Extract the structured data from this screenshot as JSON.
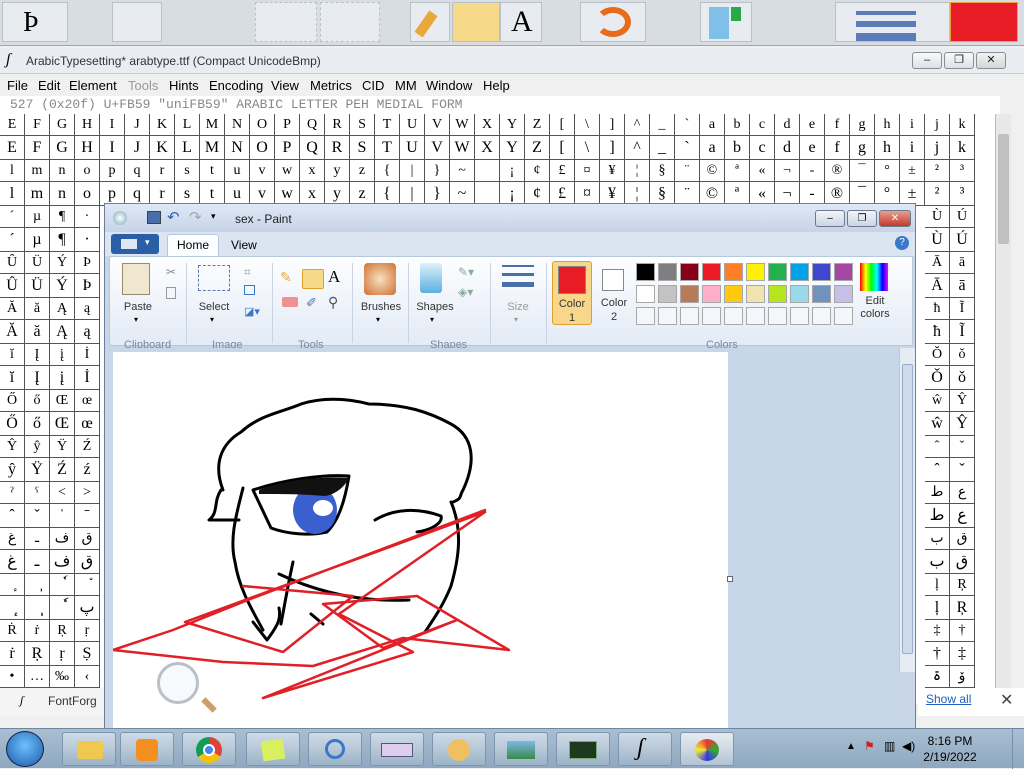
{
  "fontforge": {
    "title": "ArabicTypesetting* arabtype.ttf (Compact UnicodeBmp)",
    "menu": [
      "File",
      "Edit",
      "Element",
      "Tools",
      "Hints",
      "Encoding",
      "View",
      "Metrics",
      "CID",
      "MM",
      "Window",
      "Help"
    ],
    "info": "527 (0x20f) U+FB59 \"uniFB59\" ARABIC LETTER PEH MEDIAL FORM",
    "row1": [
      "E",
      "F",
      "G",
      "H",
      "I",
      "J",
      "K",
      "L",
      "M",
      "N",
      "O",
      "P",
      "Q",
      "R",
      "S",
      "T",
      "U",
      "V",
      "W",
      "X",
      "Y",
      "Z",
      "[",
      "\\",
      "]",
      "^",
      "_",
      "`",
      "a",
      "b",
      "c",
      "d",
      "e",
      "f",
      "g",
      "h",
      "i",
      "j",
      "k"
    ],
    "row2": [
      "E",
      "F",
      "G",
      "H",
      "I",
      "J",
      "K",
      "L",
      "M",
      "N",
      "O",
      "P",
      "Q",
      "R",
      "S",
      "T",
      "U",
      "V",
      "W",
      "X",
      "Y",
      "Z",
      "[",
      "\\",
      "]",
      "^",
      "_",
      "`",
      "a",
      "b",
      "c",
      "d",
      "e",
      "f",
      "g",
      "h",
      "i",
      "j",
      "k"
    ],
    "row3": [
      "l",
      "m",
      "n",
      "o",
      "p",
      "q",
      "r",
      "s",
      "t",
      "u",
      "v",
      "w",
      "x",
      "y",
      "z",
      "{",
      "|",
      "}",
      "~",
      "",
      "¡",
      "¢",
      "£",
      "¤",
      "¥",
      "¦",
      "§",
      "¨",
      "©",
      "ª",
      "«",
      "¬",
      "-",
      "®",
      "¯",
      "°",
      "±",
      "²",
      "³"
    ],
    "row4": [
      "l",
      "m",
      "n",
      "o",
      "p",
      "q",
      "r",
      "s",
      "t",
      "u",
      "v",
      "w",
      "x",
      "y",
      "z",
      "{",
      "|",
      "}",
      "~",
      "",
      "¡",
      "¢",
      "£",
      "¤",
      "¥",
      "¦",
      "§",
      "¨",
      "©",
      "ª",
      "«",
      "¬",
      "-",
      "®",
      "¯",
      "°",
      "±",
      "²",
      "³"
    ],
    "left_rows": [
      [
        "´",
        "µ",
        "¶",
        "·"
      ],
      [
        "´",
        "µ",
        "¶",
        "·"
      ],
      [
        "Û",
        "Ü",
        "Ý",
        "Þ"
      ],
      [
        "Û",
        "Ü",
        "Ý",
        "Þ"
      ],
      [
        "Ă",
        "ă",
        "Ą",
        "ą"
      ],
      [
        "Ă",
        "ă",
        "Ą",
        "ą"
      ],
      [
        "ĭ",
        "Į",
        "į",
        "İ"
      ],
      [
        "ĭ",
        "Į",
        "į",
        "İ"
      ],
      [
        "Ő",
        "ő",
        "Œ",
        "œ"
      ],
      [
        "Ő",
        "ő",
        "Œ",
        "œ"
      ],
      [
        "Ŷ",
        "ŷ",
        "Ÿ",
        "Ź"
      ],
      [
        "ŷ",
        "Ÿ",
        "Ź",
        "ź"
      ],
      [
        "ˀ",
        "ˁ",
        "˂",
        "˃"
      ],
      [
        "ˆ",
        "ˇ",
        "ˈ",
        "ˉ"
      ],
      [
        "غ",
        "ـ",
        "ف",
        "ق"
      ],
      [
        "غ",
        "ـ",
        "ف",
        "ق"
      ],
      [
        "ٕ",
        "ٖ",
        "ٗ",
        "٘"
      ],
      [
        "ٕ",
        "ٖ",
        "ٗ",
        "پ"
      ],
      [
        "Ṙ",
        "ṙ",
        "Ṛ",
        "ṛ"
      ],
      [
        "ṙ",
        "Ṛ",
        "ṛ",
        "Ṣ"
      ],
      [
        "•",
        "…",
        "‰",
        "‹"
      ],
      [
        "•",
        "…",
        "‰",
        "‹"
      ]
    ],
    "right_rows": [
      [
        "Ù",
        "Ú"
      ],
      [
        "Ù",
        "Ú"
      ],
      [
        "Ā",
        "ā"
      ],
      [
        "Ā",
        "ā"
      ],
      [
        "ħ",
        "Ĩ"
      ],
      [
        "ħ",
        "Ĩ"
      ],
      [
        "Ǒ",
        "ǒ"
      ],
      [
        "Ǒ",
        "ǒ"
      ],
      [
        "ŵ",
        "Ŷ"
      ],
      [
        "ŵ",
        "Ŷ"
      ],
      [
        "ˆ",
        "ˇ"
      ],
      [
        "ˆ",
        "ˇ"
      ],
      [
        "ط",
        "ع"
      ],
      [
        "ط",
        "ع"
      ],
      [
        "ب",
        "ق"
      ],
      [
        "ب",
        "ق"
      ],
      [
        "ļ",
        "Ŗ"
      ],
      [
        "ļ",
        "Ŗ"
      ],
      [
        "‡",
        "†"
      ],
      [
        "†",
        "‡"
      ],
      [
        "ۃ",
        "ۆ"
      ],
      [
        "ۈ",
        "ۇ"
      ]
    ],
    "panel_label": "FontForg",
    "show_all": "Show all",
    "window_buttons": [
      "–",
      "❐",
      "✕"
    ]
  },
  "paint": {
    "title": "sex - Paint",
    "tabs": {
      "home": "Home",
      "view": "View"
    },
    "clipboard": {
      "paste": "Paste",
      "group": "Clipboard"
    },
    "image": {
      "select": "Select",
      "group": "Image"
    },
    "tools": {
      "group": "Tools"
    },
    "brushes": "Brushes",
    "shapes": {
      "label": "Shapes",
      "group": "Shapes"
    },
    "size": "Size",
    "color1": {
      "label": "Color",
      "num": "1",
      "value": "#e81c24"
    },
    "color2": {
      "label": "Color",
      "num": "2",
      "value": "#ffffff"
    },
    "colors_group": "Colors",
    "edit_colors": {
      "l1": "Edit",
      "l2": "colors"
    },
    "palette_row1": [
      "#000000",
      "#7f7f7f",
      "#880015",
      "#ed1c24",
      "#ff7f27",
      "#fff200",
      "#22b14c",
      "#00a2e8",
      "#3f48cc",
      "#a349a4"
    ],
    "palette_row2": [
      "#ffffff",
      "#c3c3c3",
      "#b97a57",
      "#ffaec9",
      "#ffc90e",
      "#efe4b0",
      "#b5e61d",
      "#99d9ea",
      "#7092be",
      "#c8bfe7"
    ]
  },
  "taskbar": {
    "time": "8:16 PM",
    "date": "2/19/2022",
    "apps": [
      "explorer",
      "media-player",
      "chrome",
      "sticky-notes",
      "magnifier",
      "keyboard",
      "paint-bucket",
      "photo-gallery",
      "task-manager",
      "fontforge",
      "paint"
    ]
  },
  "top_strip_icons": [
    "ff-p-glyph",
    "ff-doc",
    "ff-dashed",
    "ff-dashed2",
    "ff-pencil",
    "ff-bucket",
    "ff-text",
    "ff-brush",
    "ff-spray",
    "ff-lines",
    "ff-red"
  ]
}
